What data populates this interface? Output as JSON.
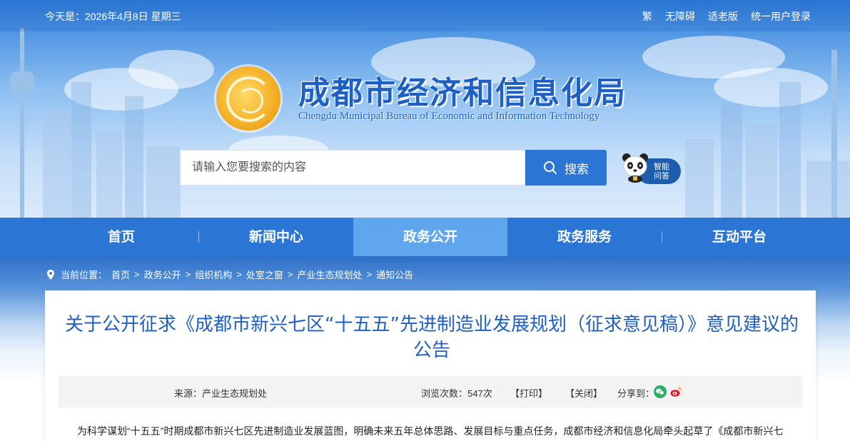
{
  "topbar": {
    "date": "今天是：2026年4月8日  星期三",
    "links": [
      "繁",
      "无障碍",
      "适老版",
      "统一用户登录"
    ]
  },
  "header": {
    "title": "成都市经济和信息化局",
    "subtitle": "Chengdu Municipal Bureau of Economic and Information Technology"
  },
  "search": {
    "placeholder": "请输入您要搜索的内容",
    "button_label": "搜索"
  },
  "assistant": {
    "label_line1": "智能",
    "label_line2": "问答"
  },
  "nav": {
    "items": [
      "首页",
      "新闻中心",
      "政务公开",
      "政务服务",
      "互动平台"
    ],
    "active": "政务公开"
  },
  "breadcrumb": {
    "prefix": "当前位置：",
    "items": [
      "首页",
      "政务公开",
      "组织机构",
      "处室之窗",
      "产业生态规划处",
      "通知公告"
    ]
  },
  "article": {
    "title": "关于公开征求《成都市新兴七区“十五五”先进制造业发展规划（征求意见稿）》意见建议的公告",
    "source": "来源：产业生态规划处",
    "views": "浏览次数：547次",
    "print_label": "【打印】",
    "close_label": "【关闭】",
    "share_label": "分享到：",
    "first_line": "为科学谋划“十五五”时期成都市新兴七区先进制造业发展蓝图，明确未来五年总体思路、发展目标与重点任务，成都市经济和信息化局牵头起草了《成都市新兴七"
  },
  "colors": {
    "primary": "#2b75d4",
    "nav_active": "#5fa6ef",
    "title_blue": "#1d5fc4",
    "meta_bg": "#f3f3f3"
  },
  "icons": [
    "location-pin-icon",
    "search-icon",
    "wechat-icon",
    "weibo-icon",
    "logo-emblem",
    "panda-mascot"
  ]
}
